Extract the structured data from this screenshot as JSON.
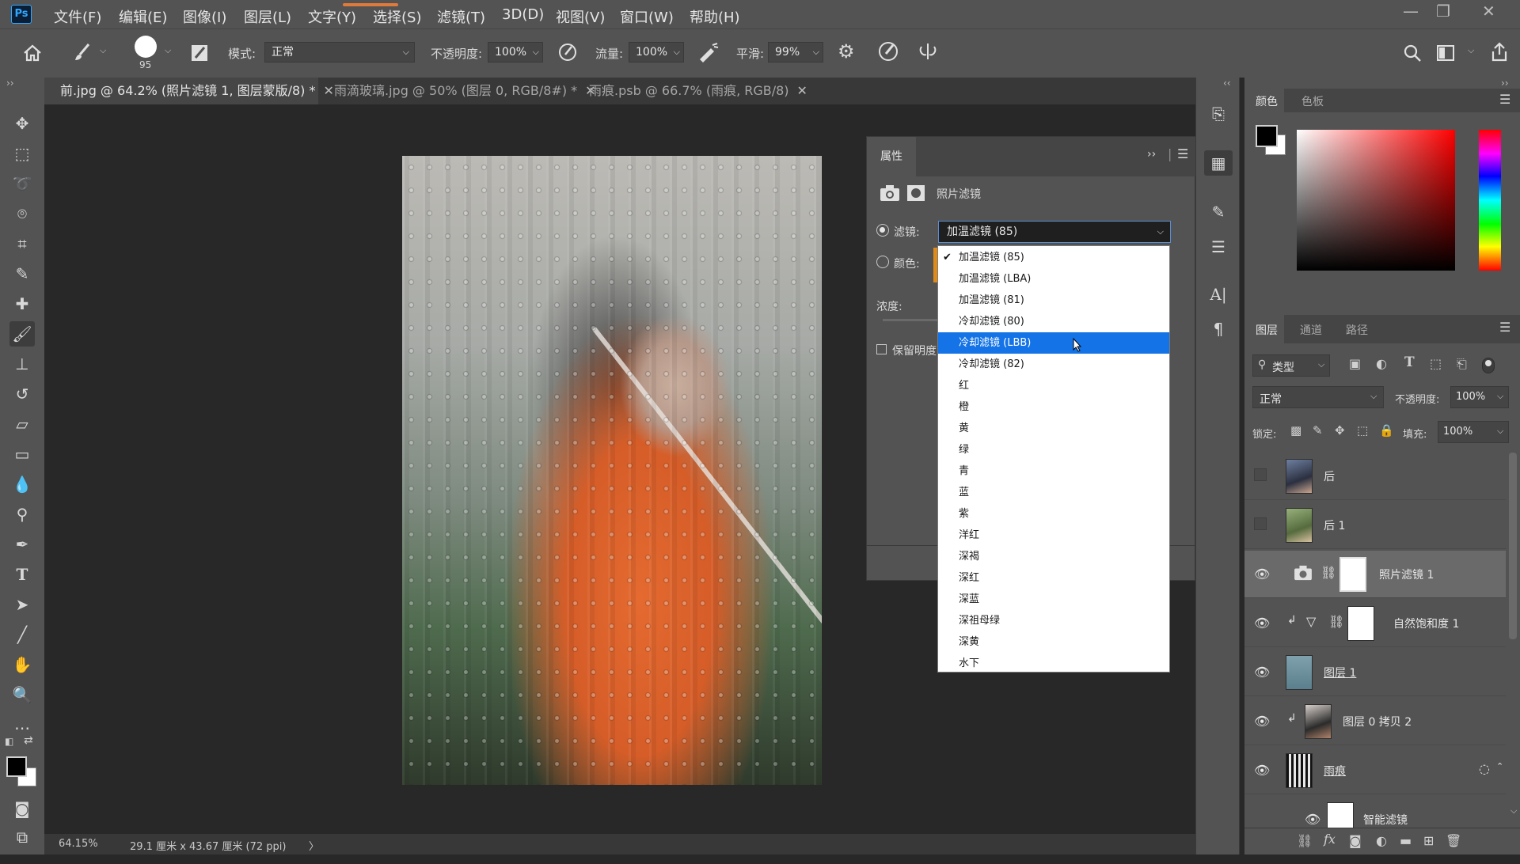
{
  "app": {
    "logo": "Ps"
  },
  "menu": [
    "文件(F)",
    "编辑(E)",
    "图像(I)",
    "图层(L)",
    "文字(Y)",
    "选择(S)",
    "滤镜(T)",
    "3D(D)",
    "视图(V)",
    "窗口(W)",
    "帮助(H)"
  ],
  "window_controls": {
    "minimize": "—",
    "restore": "❐",
    "close": "✕"
  },
  "options": {
    "brush_size": "95",
    "mode_label": "模式:",
    "mode_value": "正常",
    "opacity_label": "不透明度:",
    "opacity_value": "100%",
    "flow_label": "流量:",
    "flow_value": "100%",
    "smooth_label": "平滑:",
    "smooth_value": "99%"
  },
  "doc_tabs": [
    {
      "label": "前.jpg @ 64.2% (照片滤镜 1, 图层蒙版/8) *",
      "active": true
    },
    {
      "label": "雨滴玻璃.jpg @ 50% (图层 0, RGB/8#) *",
      "active": false
    },
    {
      "label": "雨痕.psb @ 66.7% (雨痕, RGB/8)",
      "active": false
    }
  ],
  "tab_close": "✕",
  "status": {
    "zoom": "64.15%",
    "doc_size": "29.1 厘米 x 43.67 厘米 (72 ppi)",
    "arrow": "〉"
  },
  "properties": {
    "tab": "属性",
    "title": "照片滤镜",
    "filter_label": "滤镜:",
    "filter_value": "加温滤镜 (85)",
    "color_label": "颜色:",
    "density_label": "浓度:",
    "preserve_label": "保留明度"
  },
  "dropdown_items": [
    "加温滤镜 (85)",
    "加温滤镜 (LBA)",
    "加温滤镜 (81)",
    "冷却滤镜 (80)",
    "冷却滤镜 (LBB)",
    "冷却滤镜 (82)",
    "红",
    "橙",
    "黄",
    "绿",
    "青",
    "蓝",
    "紫",
    "洋红",
    "深褐",
    "深红",
    "深蓝",
    "深祖母绿",
    "深黄",
    "水下"
  ],
  "dropdown_checked": "加温滤镜 (85)",
  "dropdown_highlight": "冷却滤镜 (LBB)",
  "color_panel": {
    "tabs": [
      "颜色",
      "色板"
    ]
  },
  "layers_panel": {
    "tabs": [
      "图层",
      "通道",
      "路径"
    ],
    "kind_label": "类型",
    "blend_mode": "正常",
    "opacity_label": "不透明度:",
    "opacity_value": "100%",
    "lock_label": "锁定:",
    "fill_label": "填充:",
    "fill_value": "100%"
  },
  "layers": [
    {
      "name": "后",
      "visible": false
    },
    {
      "name": "后 1",
      "visible": false
    },
    {
      "name": "照片滤镜 1",
      "visible": true,
      "active": true
    },
    {
      "name": "自然饱和度 1",
      "visible": true
    },
    {
      "name": "图层 1",
      "visible": true
    },
    {
      "name": "图层 0 拷贝 2",
      "visible": true
    },
    {
      "name": "雨痕",
      "visible": true
    },
    {
      "name": "智能滤镜",
      "visible": true
    }
  ],
  "colors": {
    "accent": "#1473e6",
    "panel": "#535353",
    "bg": "#282828"
  }
}
